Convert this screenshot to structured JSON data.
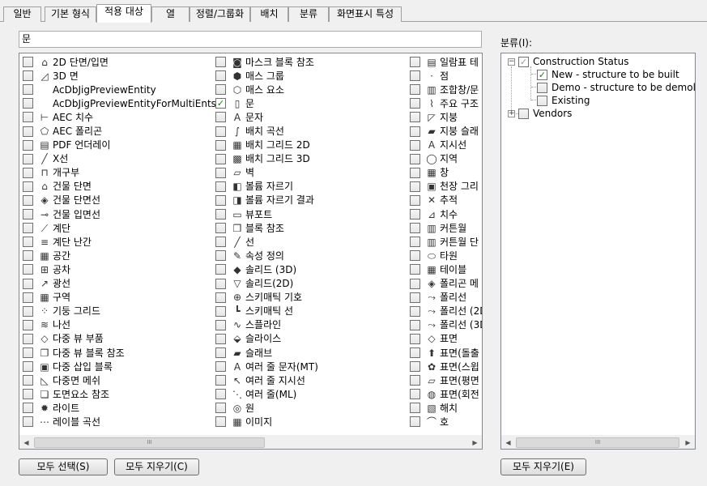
{
  "tabs": [
    {
      "label": "일반"
    },
    {
      "label": "기본 형식"
    },
    {
      "label": "적용 대상",
      "active": true
    },
    {
      "label": "열"
    },
    {
      "label": "정렬/그룹화"
    },
    {
      "label": "배치"
    },
    {
      "label": "분류"
    },
    {
      "label": "화면표시 특성"
    }
  ],
  "filter": {
    "value": "문"
  },
  "object_list": {
    "columns": [
      [
        {
          "label": "2D 단면/입면",
          "icon": "building-section-icon",
          "glyph": "⌂",
          "checked": false
        },
        {
          "label": "3D 면",
          "icon": "3d-face-icon",
          "glyph": "◿",
          "checked": false
        },
        {
          "label": "AcDbJigPreviewEntity",
          "icon": "blank-icon",
          "glyph": "",
          "checked": false
        },
        {
          "label": "AcDbJigPreviewEntityForMultiEnts",
          "icon": "blank-icon",
          "glyph": "",
          "checked": false
        },
        {
          "label": "AEC 치수",
          "icon": "aec-dimension-icon",
          "glyph": "⊢",
          "checked": false
        },
        {
          "label": "AEC 폴리곤",
          "icon": "polygon-icon",
          "glyph": "⬠",
          "checked": false
        },
        {
          "label": "PDF 언더레이",
          "icon": "pdf-icon",
          "glyph": "▤",
          "checked": false
        },
        {
          "label": "X선",
          "icon": "xline-icon",
          "glyph": "╱",
          "checked": false
        },
        {
          "label": "개구부",
          "icon": "opening-icon",
          "glyph": "⊓",
          "checked": false
        },
        {
          "label": "건물 단면",
          "icon": "building-section-icon",
          "glyph": "⌂",
          "checked": false
        },
        {
          "label": "건물 단면선",
          "icon": "section-line-icon",
          "glyph": "◈",
          "checked": false
        },
        {
          "label": "건물 입면선",
          "icon": "elevation-line-icon",
          "glyph": "⊸",
          "checked": false
        },
        {
          "label": "계단",
          "icon": "stair-icon",
          "glyph": "⟋",
          "checked": false
        },
        {
          "label": "계단 난간",
          "icon": "railing-icon",
          "glyph": "≡",
          "checked": false
        },
        {
          "label": "공간",
          "icon": "space-icon",
          "glyph": "▦",
          "checked": false
        },
        {
          "label": "공차",
          "icon": "tolerance-icon",
          "glyph": "⊞",
          "checked": false
        },
        {
          "label": "광선",
          "icon": "ray-icon",
          "glyph": "↗",
          "checked": false
        },
        {
          "label": "구역",
          "icon": "zone-icon",
          "glyph": "▦",
          "checked": false
        },
        {
          "label": "기둥 그리드",
          "icon": "column-grid-icon",
          "glyph": "⁘",
          "checked": false
        },
        {
          "label": "나선",
          "icon": "helix-icon",
          "glyph": "≋",
          "checked": false
        },
        {
          "label": "다중 뷰 부품",
          "icon": "multi-view-part-icon",
          "glyph": "◇",
          "checked": false
        },
        {
          "label": "다중 뷰 블록 참조",
          "icon": "multi-view-block-icon",
          "glyph": "❐",
          "checked": false
        },
        {
          "label": "다중 삽입 블록",
          "icon": "minsert-icon",
          "glyph": "▣",
          "checked": false
        },
        {
          "label": "다중면 메쉬",
          "icon": "polyface-mesh-icon",
          "glyph": "◺",
          "checked": false
        },
        {
          "label": "도면요소 참조",
          "icon": "element-ref-icon",
          "glyph": "❏",
          "checked": false
        },
        {
          "label": "라이트",
          "icon": "light-icon",
          "glyph": "✹",
          "checked": false
        },
        {
          "label": "레이블 곡선",
          "icon": "label-curve-icon",
          "glyph": "⋯",
          "checked": false
        }
      ],
      [
        {
          "label": "마스크 블록 참조",
          "icon": "mask-block-icon",
          "glyph": "◙",
          "checked": false
        },
        {
          "label": "매스 그룹",
          "icon": "mass-group-icon",
          "glyph": "⬢",
          "checked": false
        },
        {
          "label": "매스 요소",
          "icon": "mass-element-icon",
          "glyph": "⬡",
          "checked": false
        },
        {
          "label": "문",
          "icon": "door-icon",
          "glyph": "▯",
          "checked": true
        },
        {
          "label": "문자",
          "icon": "text-icon",
          "glyph": "A",
          "checked": false
        },
        {
          "label": "배치 곡선",
          "icon": "layout-curve-icon",
          "glyph": "∫",
          "checked": false
        },
        {
          "label": "배치 그리드 2D",
          "icon": "layout-grid-2d-icon",
          "glyph": "▦",
          "checked": false
        },
        {
          "label": "배치 그리드 3D",
          "icon": "layout-grid-3d-icon",
          "glyph": "▩",
          "checked": false
        },
        {
          "label": "벽",
          "icon": "wall-icon",
          "glyph": "▱",
          "checked": false
        },
        {
          "label": "볼륨 자르기",
          "icon": "volume-cut-icon",
          "glyph": "◧",
          "checked": false
        },
        {
          "label": "볼륨 자르기 결과",
          "icon": "volume-cut-result-icon",
          "glyph": "◨",
          "checked": false
        },
        {
          "label": "뷰포트",
          "icon": "viewport-icon",
          "glyph": "▭",
          "checked": false
        },
        {
          "label": "블록 참조",
          "icon": "block-ref-icon",
          "glyph": "❒",
          "checked": false
        },
        {
          "label": "선",
          "icon": "line-icon",
          "glyph": "╱",
          "checked": false
        },
        {
          "label": "속성 정의",
          "icon": "attribute-def-icon",
          "glyph": "✎",
          "checked": false
        },
        {
          "label": "솔리드 (3D)",
          "icon": "solid-3d-icon",
          "glyph": "◆",
          "checked": false
        },
        {
          "label": "솔리드(2D)",
          "icon": "solid-2d-icon",
          "glyph": "▽",
          "checked": false
        },
        {
          "label": "스키매틱 기호",
          "icon": "schematic-symbol-icon",
          "glyph": "⊕",
          "checked": false
        },
        {
          "label": "스키매틱 선",
          "icon": "schematic-line-icon",
          "glyph": "┗",
          "checked": false
        },
        {
          "label": "스플라인",
          "icon": "spline-icon",
          "glyph": "∿",
          "checked": false
        },
        {
          "label": "슬라이스",
          "icon": "slice-icon",
          "glyph": "⬙",
          "checked": false
        },
        {
          "label": "슬래브",
          "icon": "slab-icon",
          "glyph": "▰",
          "checked": false
        },
        {
          "label": "여러 줄 문자(MT)",
          "icon": "mtext-icon",
          "glyph": "A",
          "checked": false
        },
        {
          "label": "여러 줄 지시선",
          "icon": "multileader-icon",
          "glyph": "↖",
          "checked": false
        },
        {
          "label": "여러 줄(ML)",
          "icon": "mline-icon",
          "glyph": "⋱",
          "checked": false
        },
        {
          "label": "원",
          "icon": "circle-icon",
          "glyph": "◎",
          "checked": false
        },
        {
          "label": "이미지",
          "icon": "image-icon",
          "glyph": "▦",
          "checked": false
        }
      ],
      [
        {
          "label": "일람표 테",
          "icon": "schedule-table-icon",
          "glyph": "▤",
          "checked": false
        },
        {
          "label": "점",
          "icon": "point-icon",
          "glyph": "·",
          "checked": false
        },
        {
          "label": "조합창/문",
          "icon": "door-window-assembly-icon",
          "glyph": "▥",
          "checked": false
        },
        {
          "label": "주요 구조",
          "icon": "structural-member-icon",
          "glyph": "⌇",
          "checked": false
        },
        {
          "label": "지붕",
          "icon": "roof-icon",
          "glyph": "◸",
          "checked": false
        },
        {
          "label": "지붕 슬래",
          "icon": "roof-slab-icon",
          "glyph": "▰",
          "checked": false
        },
        {
          "label": "지시선",
          "icon": "leader-icon",
          "glyph": "A",
          "checked": false
        },
        {
          "label": "지역",
          "icon": "region-icon",
          "glyph": "◯",
          "checked": false
        },
        {
          "label": "창",
          "icon": "window-icon",
          "glyph": "▦",
          "checked": false
        },
        {
          "label": "천장 그리",
          "icon": "ceiling-grid-icon",
          "glyph": "▣",
          "checked": false
        },
        {
          "label": "추적",
          "icon": "trace-icon",
          "glyph": "✕",
          "checked": false
        },
        {
          "label": "치수",
          "icon": "dimension-icon",
          "glyph": "⊿",
          "checked": false
        },
        {
          "label": "커튼월",
          "icon": "curtain-wall-icon",
          "glyph": "▥",
          "checked": false
        },
        {
          "label": "커튼월 단",
          "icon": "curtain-wall-unit-icon",
          "glyph": "▥",
          "checked": false
        },
        {
          "label": "타원",
          "icon": "ellipse-icon",
          "glyph": "⬭",
          "checked": false
        },
        {
          "label": "테이블",
          "icon": "table-icon",
          "glyph": "▦",
          "checked": false
        },
        {
          "label": "폴리곤 메",
          "icon": "polygon-mesh-icon",
          "glyph": "◈",
          "checked": false
        },
        {
          "label": "폴리선",
          "icon": "polyline-icon",
          "glyph": "⤳",
          "checked": false
        },
        {
          "label": "폴리선 (2D",
          "icon": "polyline-2d-icon",
          "glyph": "⤳",
          "checked": false
        },
        {
          "label": "폴리선 (3D",
          "icon": "polyline-3d-icon",
          "glyph": "⤳",
          "checked": false
        },
        {
          "label": "표면",
          "icon": "surface-icon",
          "glyph": "◇",
          "checked": false
        },
        {
          "label": "표면(돌출",
          "icon": "surface-extrude-icon",
          "glyph": "⬆",
          "checked": false
        },
        {
          "label": "표면(스윕",
          "icon": "surface-sweep-icon",
          "glyph": "✿",
          "checked": false
        },
        {
          "label": "표면(평면",
          "icon": "surface-planar-icon",
          "glyph": "▱",
          "checked": false
        },
        {
          "label": "표면(회전",
          "icon": "surface-revolve-icon",
          "glyph": "◍",
          "checked": false
        },
        {
          "label": "해치",
          "icon": "hatch-icon",
          "glyph": "▧",
          "checked": false
        },
        {
          "label": "호",
          "icon": "arc-icon",
          "glyph": "⌒",
          "checked": false
        }
      ]
    ]
  },
  "category": {
    "label": "분류(I):",
    "tree": [
      {
        "label": "Construction Status",
        "expander": "−",
        "checked": "partial",
        "level": 0
      },
      {
        "label": "New - structure to be built",
        "checked": true,
        "level": 1
      },
      {
        "label": "Demo - structure to be demolis",
        "checked": false,
        "level": 1
      },
      {
        "label": "Existing",
        "checked": false,
        "level": 1
      },
      {
        "label": "Vendors",
        "expander": "+",
        "checked": false,
        "level": 0
      }
    ]
  },
  "buttons": {
    "select_all": "모두 선택(S)",
    "clear_all": "모두 지우기(C)",
    "clear_all_category": "모두 지우기(E)"
  },
  "scrollbar": {
    "grip": "III",
    "left_arrow": "◀",
    "right_arrow": "▶"
  }
}
